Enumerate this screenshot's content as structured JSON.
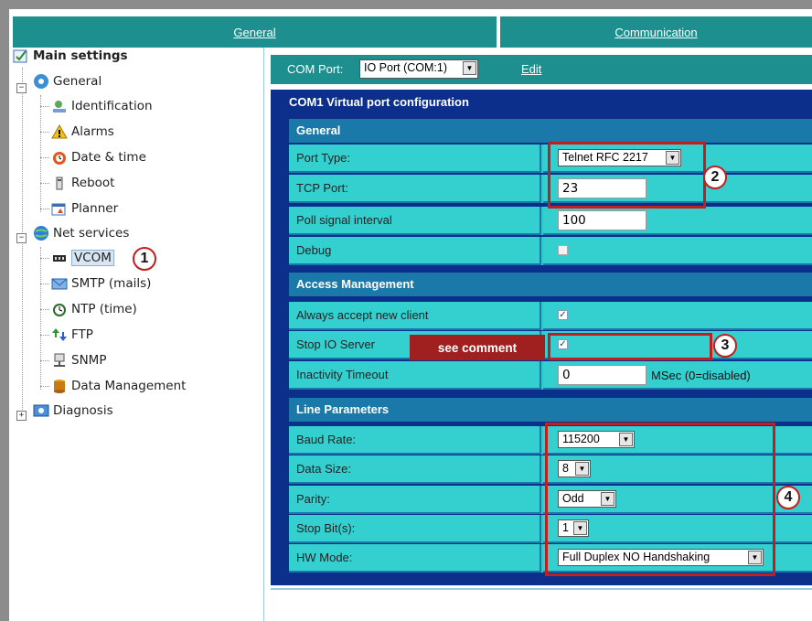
{
  "tabs": {
    "general": "General",
    "communication": "Communication"
  },
  "tree": {
    "main": "Main settings",
    "general": "General",
    "general_items": [
      "Identification",
      "Alarms",
      "Date & time",
      "Reboot",
      "Planner"
    ],
    "net_services": "Net services",
    "net_items": [
      "VCOM",
      "SMTP (mails)",
      "NTP (time)",
      "FTP",
      "SNMP",
      "Data Management"
    ],
    "diagnosis": "Diagnosis"
  },
  "com_port": {
    "label": "COM Port:",
    "value": "IO Port (COM:1)",
    "edit": "Edit"
  },
  "panel_title": "COM1 Virtual port configuration",
  "sections": {
    "general": {
      "title": "General",
      "port_type": {
        "label": "Port Type:",
        "value": "Telnet RFC 2217"
      },
      "tcp_port": {
        "label": "TCP Port:",
        "value": "23"
      },
      "poll": {
        "label": "Poll signal interval",
        "value": "100"
      },
      "debug": {
        "label": "Debug",
        "checked": false
      }
    },
    "access": {
      "title": "Access Management",
      "always_accept": {
        "label": "Always accept new client",
        "checked": true
      },
      "stop_io": {
        "label": "Stop IO Server",
        "checked": true
      },
      "inactivity": {
        "label": "Inactivity Timeout",
        "value": "0",
        "unit": "MSec (0=disabled)"
      }
    },
    "line": {
      "title": "Line Parameters",
      "baud": {
        "label": "Baud Rate:",
        "value": "115200"
      },
      "data_size": {
        "label": "Data Size:",
        "value": "8"
      },
      "parity": {
        "label": "Parity:",
        "value": "Odd"
      },
      "stop_bits": {
        "label": "Stop Bit(s):",
        "value": "1"
      },
      "hw_mode": {
        "label": "HW Mode:",
        "value": "Full Duplex NO Handshaking"
      }
    }
  },
  "annotations": {
    "comment": "see comment",
    "callouts": [
      "1",
      "2",
      "3",
      "4"
    ],
    "callout_color": "#c21e1e"
  },
  "colors": {
    "teal": "#1e8f8f",
    "navy": "#0d2f8c",
    "cyan": "#34cfcf",
    "section": "#1a79a8"
  }
}
